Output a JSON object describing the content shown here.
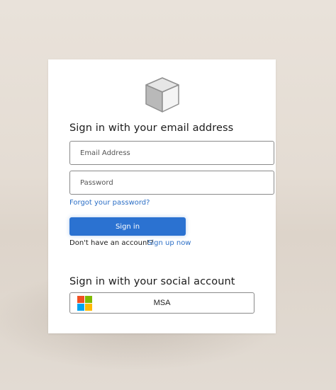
{
  "email_section": {
    "heading": "Sign in with your email address",
    "email_placeholder": "Email Address",
    "password_placeholder": "Password",
    "forgot_password": "Forgot your password?",
    "signin_label": "Sign in",
    "no_account_text": "Don't have an account?",
    "signup_link": "Sign up now"
  },
  "social_section": {
    "heading": "Sign in with your social account",
    "msa_label": "MSA"
  },
  "colors": {
    "primary": "#2b72d1",
    "link": "#2c6fc6",
    "ms_red": "#f25022",
    "ms_green": "#7fba00",
    "ms_blue": "#00a4ef",
    "ms_yellow": "#ffb900"
  },
  "icons": {
    "logo": "cube-icon",
    "social": "microsoft-logo-icon"
  }
}
